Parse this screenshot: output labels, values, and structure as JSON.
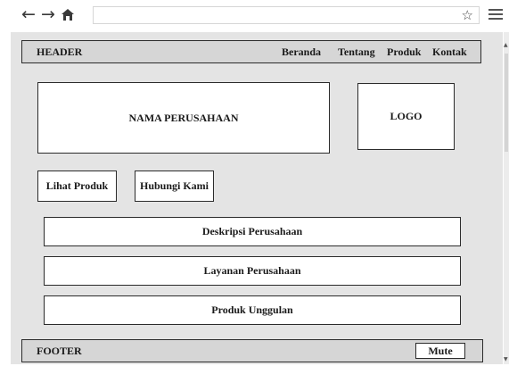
{
  "browser": {
    "back_icon": "←",
    "forward_icon": "→",
    "home_icon": "home-icon",
    "bookmark_icon": "☆",
    "menu_icon": "hamburger-menu-icon"
  },
  "header": {
    "title": "HEADER",
    "nav": [
      "Beranda",
      "Tentang",
      "Produk",
      "Kontak"
    ]
  },
  "hero": {
    "company_name": "NAMA PERUSAHAAN",
    "logo": "LOGO"
  },
  "actions": {
    "view_products": "Lihat Produk",
    "contact_us": "Hubungi Kami"
  },
  "sections": [
    "Deskripsi Perusahaan",
    "Layanan Perusahaan",
    "Produk Unggulan"
  ],
  "footer": {
    "title": "FOOTER",
    "mute_label": "Mute"
  }
}
